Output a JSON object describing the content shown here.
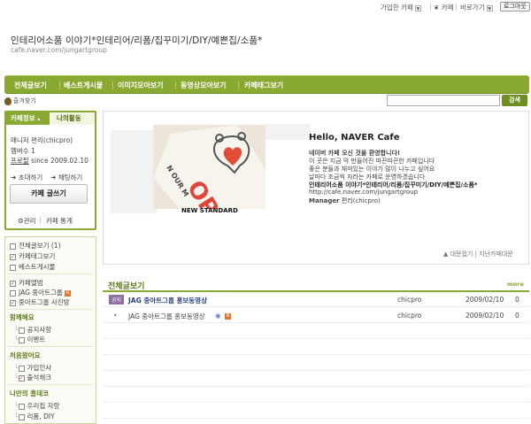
{
  "topbar": {
    "joined_cafe": "가입한 카페",
    "cafe_label": "카페",
    "shortcut": "바로가기",
    "logout": "로그아웃"
  },
  "cafe": {
    "title": "인테리어소품 이야기*인테리어/리폼/집꾸미기/DIY/예쁜집/소품*",
    "url": "cafe.naver.com/jungartgroup"
  },
  "nav": {
    "items": [
      "전체글보기",
      "베스트게시물",
      "이미지모아보기",
      "동영상모아보기",
      "카페태그보기"
    ]
  },
  "favorite": "즐겨찾기",
  "search": {
    "button": "검색"
  },
  "sidebar": {
    "tab_info": "카페정보",
    "tab_activity": "나의활동",
    "manager_line": "매니저 편리(chicpro)",
    "member_line": "멤버수 1",
    "profile_label": "프로필",
    "since": "since 2009.02.10",
    "invite": "초대하기",
    "chat": "채팅하기",
    "write_button": "카페 글쓰기",
    "admin": "관리",
    "stats": "카페 통계"
  },
  "menu": {
    "all_posts": "전체글보기 (1)",
    "tags": "카페태그보기",
    "best": "베스트게시물",
    "album": "카페앨범",
    "jag_group": "JAG 중아트그룹",
    "jag_photo": "중아트그룹 사진방",
    "group1": "함께해요",
    "notice": "공지사항",
    "event": "이벤트",
    "group2": "처음왔어요",
    "greeting": "가입인사",
    "attendance": "출석체크",
    "group3": "나만의 홈데코",
    "my_brag": "우리집 자랑",
    "reform": "리폼, DIY"
  },
  "welcome": {
    "title": "Hello, NAVER Cafe",
    "line1": "네이버 카페 오신 것을 환영합니다!",
    "line2": "이 곳은 지금 막 만들어진 따끈따끈한 카페입니다",
    "line3": "좋은 분들과 재미있는 이야기 많이 나누고 싶어요",
    "line4": "날마다 조금씩 자라는 카페로 운영하겠습니다",
    "cafe_name": "인테리어소품 이야기*인테리어/리폼/집꾸미기/DIY/예쁜집/소품*",
    "url": "http://cafe.naver.com/jungartgroup",
    "manager_label": "Manager",
    "manager_value": "편리(chicpro)",
    "banner_caption": "NEW STANDARD",
    "banner_sign": "OPEN",
    "banner_sub": "N OUR M",
    "links": "▲ 대문접기 | 지난카페대문"
  },
  "posts": {
    "section_title": "전체글보기",
    "more": "more",
    "rows": [
      {
        "badge": "공지",
        "title": "JAG 중아트그룹 홍보동영상",
        "author": "chicpro",
        "date": "2009/02/10",
        "count": "0"
      },
      {
        "badge": "",
        "title": "JAG 중아트그룹 홍보동영상",
        "author": "chicpro",
        "date": "2009/02/10",
        "count": "0"
      }
    ]
  },
  "colors": {
    "accent": "#8aa932",
    "accent_dark": "#5d7a1a",
    "notice_badge": "#8d6fa0"
  }
}
